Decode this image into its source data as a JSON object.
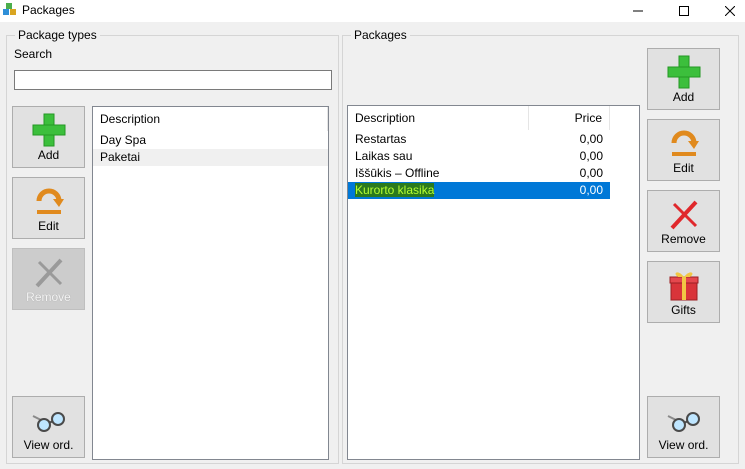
{
  "window": {
    "title": "Packages"
  },
  "left_panel": {
    "group_title": "Package types",
    "search_label": "Search",
    "search_value": "",
    "buttons": {
      "add": "Add",
      "edit": "Edit",
      "remove": "Remove",
      "view_orders": "View ord."
    },
    "list": {
      "columns": [
        "Description"
      ],
      "rows": [
        {
          "description": "Day Spa"
        },
        {
          "description": "Paketai"
        }
      ]
    }
  },
  "right_panel": {
    "group_title": "Packages",
    "buttons": {
      "add": "Add",
      "edit": "Edit",
      "remove": "Remove",
      "gifts": "Gifts",
      "view_orders": "View ord."
    },
    "list": {
      "columns": [
        "Description",
        "Price"
      ],
      "rows": [
        {
          "description": "Restartas",
          "price": "0,00"
        },
        {
          "description": "Laikas sau",
          "price": "0,00"
        },
        {
          "description": "Iššūkis – Offline",
          "price": "0,00"
        },
        {
          "description": "Kurorto klasika",
          "price": "0,00"
        }
      ]
    }
  },
  "colors": {
    "selection": "#0078d7",
    "add_green": "#3cbf3c",
    "edit_orange": "#e08a1e",
    "remove_red": "#e0282c"
  }
}
